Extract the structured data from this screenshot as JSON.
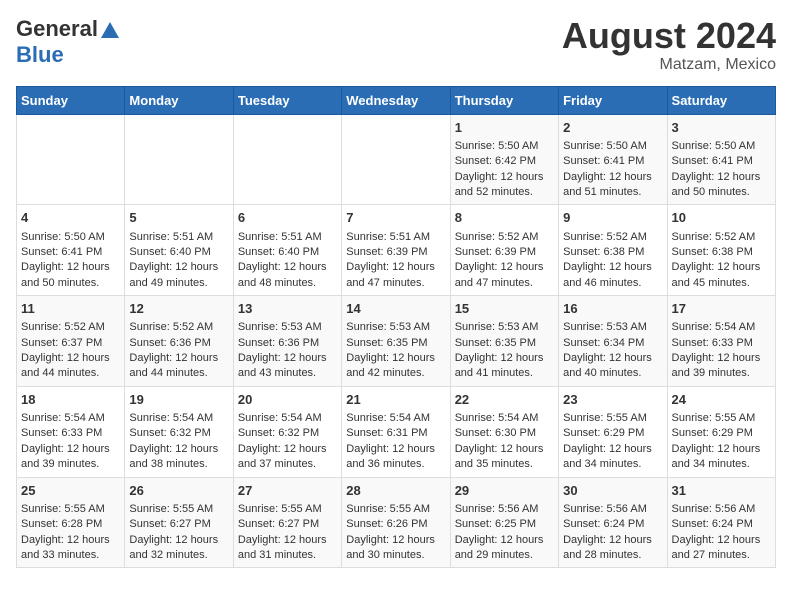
{
  "logo": {
    "general": "General",
    "blue": "Blue"
  },
  "title": "August 2024",
  "location": "Matzam, Mexico",
  "headers": [
    "Sunday",
    "Monday",
    "Tuesday",
    "Wednesday",
    "Thursday",
    "Friday",
    "Saturday"
  ],
  "weeks": [
    [
      {
        "day": "",
        "content": ""
      },
      {
        "day": "",
        "content": ""
      },
      {
        "day": "",
        "content": ""
      },
      {
        "day": "",
        "content": ""
      },
      {
        "day": "1",
        "content": "Sunrise: 5:50 AM\nSunset: 6:42 PM\nDaylight: 12 hours\nand 52 minutes."
      },
      {
        "day": "2",
        "content": "Sunrise: 5:50 AM\nSunset: 6:41 PM\nDaylight: 12 hours\nand 51 minutes."
      },
      {
        "day": "3",
        "content": "Sunrise: 5:50 AM\nSunset: 6:41 PM\nDaylight: 12 hours\nand 50 minutes."
      }
    ],
    [
      {
        "day": "4",
        "content": "Sunrise: 5:50 AM\nSunset: 6:41 PM\nDaylight: 12 hours\nand 50 minutes."
      },
      {
        "day": "5",
        "content": "Sunrise: 5:51 AM\nSunset: 6:40 PM\nDaylight: 12 hours\nand 49 minutes."
      },
      {
        "day": "6",
        "content": "Sunrise: 5:51 AM\nSunset: 6:40 PM\nDaylight: 12 hours\nand 48 minutes."
      },
      {
        "day": "7",
        "content": "Sunrise: 5:51 AM\nSunset: 6:39 PM\nDaylight: 12 hours\nand 47 minutes."
      },
      {
        "day": "8",
        "content": "Sunrise: 5:52 AM\nSunset: 6:39 PM\nDaylight: 12 hours\nand 47 minutes."
      },
      {
        "day": "9",
        "content": "Sunrise: 5:52 AM\nSunset: 6:38 PM\nDaylight: 12 hours\nand 46 minutes."
      },
      {
        "day": "10",
        "content": "Sunrise: 5:52 AM\nSunset: 6:38 PM\nDaylight: 12 hours\nand 45 minutes."
      }
    ],
    [
      {
        "day": "11",
        "content": "Sunrise: 5:52 AM\nSunset: 6:37 PM\nDaylight: 12 hours\nand 44 minutes."
      },
      {
        "day": "12",
        "content": "Sunrise: 5:52 AM\nSunset: 6:36 PM\nDaylight: 12 hours\nand 44 minutes."
      },
      {
        "day": "13",
        "content": "Sunrise: 5:53 AM\nSunset: 6:36 PM\nDaylight: 12 hours\nand 43 minutes."
      },
      {
        "day": "14",
        "content": "Sunrise: 5:53 AM\nSunset: 6:35 PM\nDaylight: 12 hours\nand 42 minutes."
      },
      {
        "day": "15",
        "content": "Sunrise: 5:53 AM\nSunset: 6:35 PM\nDaylight: 12 hours\nand 41 minutes."
      },
      {
        "day": "16",
        "content": "Sunrise: 5:53 AM\nSunset: 6:34 PM\nDaylight: 12 hours\nand 40 minutes."
      },
      {
        "day": "17",
        "content": "Sunrise: 5:54 AM\nSunset: 6:33 PM\nDaylight: 12 hours\nand 39 minutes."
      }
    ],
    [
      {
        "day": "18",
        "content": "Sunrise: 5:54 AM\nSunset: 6:33 PM\nDaylight: 12 hours\nand 39 minutes."
      },
      {
        "day": "19",
        "content": "Sunrise: 5:54 AM\nSunset: 6:32 PM\nDaylight: 12 hours\nand 38 minutes."
      },
      {
        "day": "20",
        "content": "Sunrise: 5:54 AM\nSunset: 6:32 PM\nDaylight: 12 hours\nand 37 minutes."
      },
      {
        "day": "21",
        "content": "Sunrise: 5:54 AM\nSunset: 6:31 PM\nDaylight: 12 hours\nand 36 minutes."
      },
      {
        "day": "22",
        "content": "Sunrise: 5:54 AM\nSunset: 6:30 PM\nDaylight: 12 hours\nand 35 minutes."
      },
      {
        "day": "23",
        "content": "Sunrise: 5:55 AM\nSunset: 6:29 PM\nDaylight: 12 hours\nand 34 minutes."
      },
      {
        "day": "24",
        "content": "Sunrise: 5:55 AM\nSunset: 6:29 PM\nDaylight: 12 hours\nand 34 minutes."
      }
    ],
    [
      {
        "day": "25",
        "content": "Sunrise: 5:55 AM\nSunset: 6:28 PM\nDaylight: 12 hours\nand 33 minutes."
      },
      {
        "day": "26",
        "content": "Sunrise: 5:55 AM\nSunset: 6:27 PM\nDaylight: 12 hours\nand 32 minutes."
      },
      {
        "day": "27",
        "content": "Sunrise: 5:55 AM\nSunset: 6:27 PM\nDaylight: 12 hours\nand 31 minutes."
      },
      {
        "day": "28",
        "content": "Sunrise: 5:55 AM\nSunset: 6:26 PM\nDaylight: 12 hours\nand 30 minutes."
      },
      {
        "day": "29",
        "content": "Sunrise: 5:56 AM\nSunset: 6:25 PM\nDaylight: 12 hours\nand 29 minutes."
      },
      {
        "day": "30",
        "content": "Sunrise: 5:56 AM\nSunset: 6:24 PM\nDaylight: 12 hours\nand 28 minutes."
      },
      {
        "day": "31",
        "content": "Sunrise: 5:56 AM\nSunset: 6:24 PM\nDaylight: 12 hours\nand 27 minutes."
      }
    ]
  ]
}
